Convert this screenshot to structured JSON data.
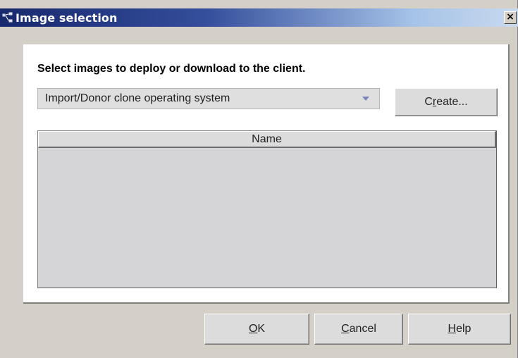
{
  "window": {
    "title": "Image selection",
    "close_label": "×"
  },
  "main": {
    "instruction": "Select images to deploy or download to the client.",
    "dropdown": {
      "selected": "Import/Donor clone operating system"
    },
    "create_button": {
      "label_pre": "C",
      "label_mnemonic": "r",
      "label_post": "eate..."
    },
    "table": {
      "columns": [
        "Name"
      ],
      "rows": []
    }
  },
  "footer": {
    "ok": {
      "mnemonic": "O",
      "rest": "K"
    },
    "cancel": {
      "mnemonic": "C",
      "rest": "ancel"
    },
    "help": {
      "mnemonic": "H",
      "rest": "elp"
    }
  },
  "icons": {
    "title": "app-window-icon",
    "dropdown": "chevron-down-icon"
  }
}
